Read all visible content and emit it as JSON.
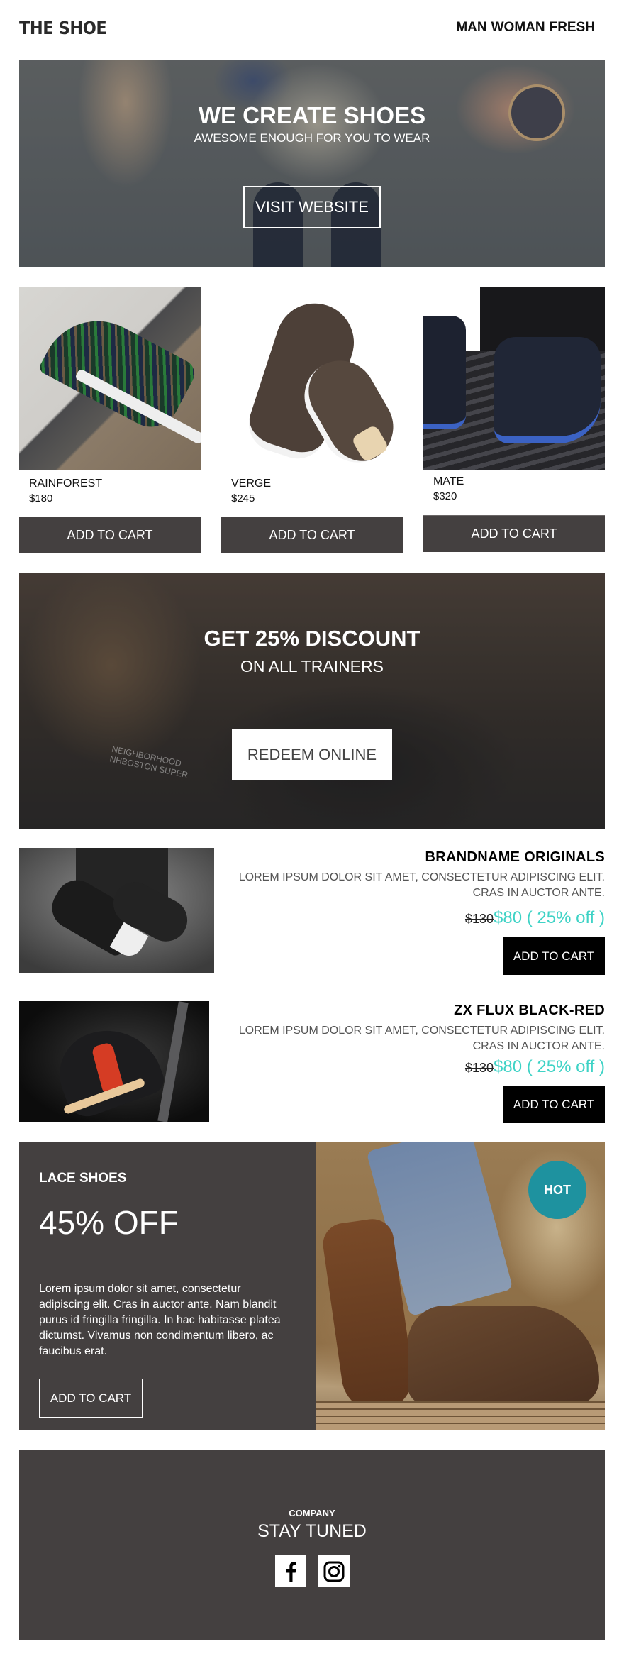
{
  "header": {
    "logo": "THE SHOE",
    "nav": [
      {
        "label": "MAN"
      },
      {
        "label": "WOMAN"
      },
      {
        "label": "FRESH"
      }
    ]
  },
  "hero": {
    "title": "WE CREATE SHOES",
    "subtitle": "AWESOME ENOUGH FOR YOU TO WEAR",
    "button_label": "VISIT WEBSITE"
  },
  "products": [
    {
      "name": "RAINFOREST",
      "price": "$180",
      "button_label": "ADD TO CART"
    },
    {
      "name": "VERGE",
      "price": "$245",
      "button_label": "ADD TO CART"
    },
    {
      "name": "MATE",
      "price": "$320",
      "button_label": "ADD TO CART"
    }
  ],
  "discount": {
    "title": "GET 25% DISCOUNT",
    "subtitle": "ON ALL TRAINERS",
    "button_label": "REDEEM ONLINE",
    "image_text_line1": "NEIGHBORHOOD",
    "image_text_line2": "NHBOSTON SUPER"
  },
  "featured": [
    {
      "title": "BRANDNAME ORIGINALS",
      "description_line1": "LOREM IPSUM DOLOR SIT AMET, CONSECTETUR ADIPISCING ELIT.",
      "description_line2": "CRAS IN AUCTOR ANTE.",
      "old_price": "$130",
      "new_price": "$80 ( 25% off )",
      "button_label": "ADD TO CART"
    },
    {
      "title": "ZX FLUX BLACK-RED",
      "description_line1": "LOREM IPSUM DOLOR SIT AMET, CONSECTETUR ADIPISCING ELIT.",
      "description_line2": "CRAS IN AUCTOR ANTE.",
      "old_price": "$130",
      "new_price": "$80 ( 25% off )",
      "button_label": "ADD TO CART"
    }
  ],
  "lace": {
    "title": "LACE SHOES",
    "offer": "45% OFF",
    "description": "Lorem ipsum dolor sit amet, consectetur adipiscing elit. Cras in auctor ante. Nam blandit purus id fringilla fringilla. In hac habitasse platea dictumst. Vivamus non condimentum libero, ac faucibus erat.",
    "button_label": "ADD TO CART",
    "badge": "HOT",
    "badge_color": "#1e929f"
  },
  "footer": {
    "company": "COMPANY",
    "tagline": "STAY TUNED",
    "socials": [
      {
        "icon": "facebook-icon"
      },
      {
        "icon": "instagram-icon"
      }
    ]
  },
  "colors": {
    "dark_panel": "#444040",
    "sale_price": "#3fd3c6",
    "hot_badge": "#1e929f"
  }
}
